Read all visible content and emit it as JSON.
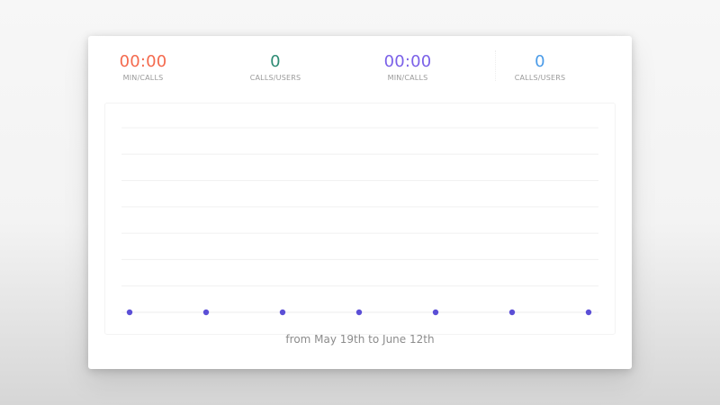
{
  "stats": [
    {
      "value": "00:00",
      "label": "MIN/CALLS",
      "color": "#f46a4e"
    },
    {
      "value": "0",
      "label": "CALLS/USERS",
      "color": "#2e8b74"
    },
    {
      "value": "00:00",
      "label": "MIN/CALLS",
      "color": "#7b61e8"
    },
    {
      "value": "0",
      "label": "CALLS/USERS",
      "color": "#4a9be8"
    }
  ],
  "chart_data": {
    "type": "line",
    "x": [
      1,
      2,
      3,
      4,
      5,
      6,
      7
    ],
    "series": [
      {
        "values": [
          0,
          0,
          0,
          0,
          0,
          0,
          0
        ],
        "color": "#5b4fd6"
      }
    ],
    "grid": true,
    "legend": "none"
  },
  "caption": "from May 19th to June 12th"
}
